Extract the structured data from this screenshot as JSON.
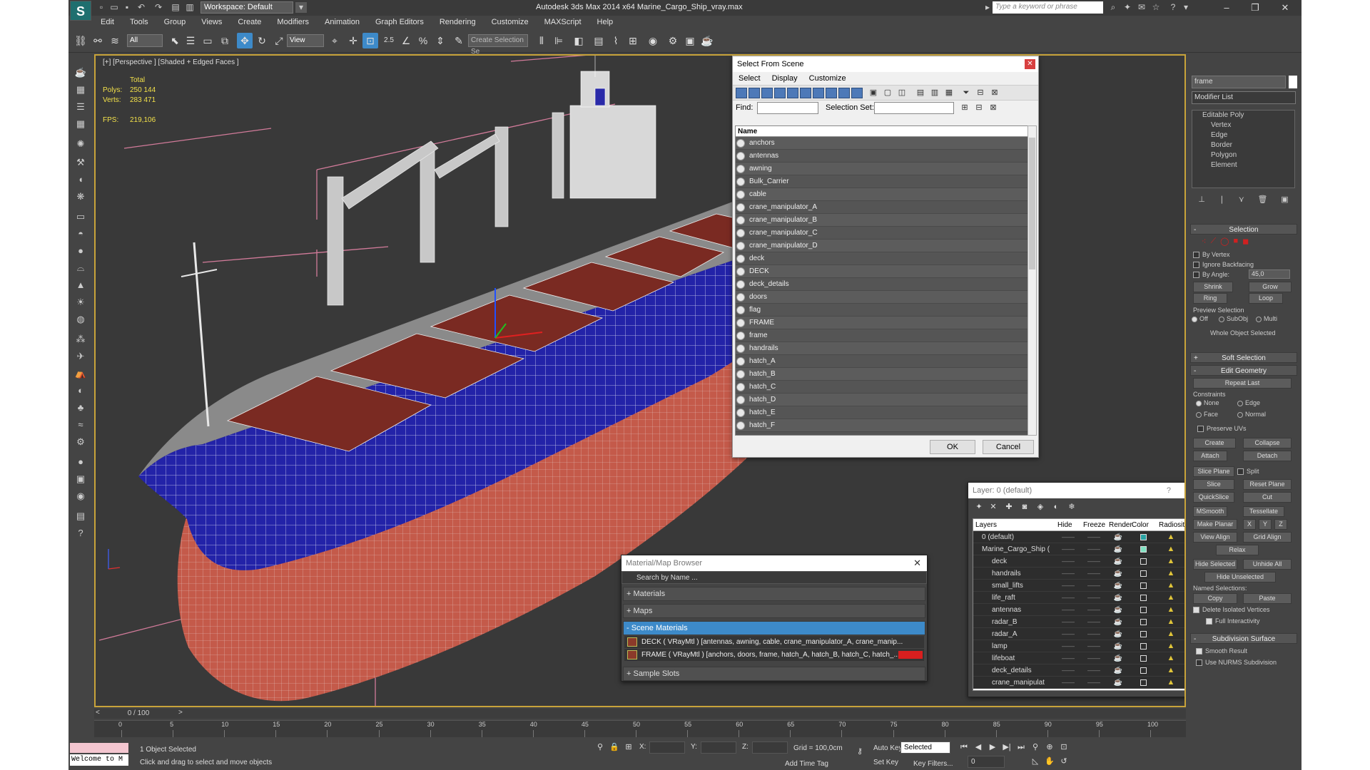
{
  "titlebar": {
    "workspace": "Workspace: Default",
    "title": "Autodesk 3ds Max  2014 x64     Marine_Cargo_Ship_vray.max",
    "search_placeholder": "Type a keyword or phrase"
  },
  "menu": [
    "Edit",
    "Tools",
    "Group",
    "Views",
    "Create",
    "Modifiers",
    "Animation",
    "Graph Editors",
    "Rendering",
    "Customize",
    "MAXScript",
    "Help"
  ],
  "toolbar": {
    "filter_value": "All",
    "refcoord_value": "View",
    "snap_angle": "2.5",
    "selection_set_placeholder": "Create Selection Se"
  },
  "viewport": {
    "label": "[+] [Perspective ] [Shaded + Edged Faces ]",
    "stats": {
      "total_label": "Total",
      "polys_label": "Polys:",
      "polys": "250 144",
      "verts_label": "Verts:",
      "verts": "283 471",
      "fps_label": "FPS:",
      "fps": "219,106"
    }
  },
  "select_from_scene": {
    "title": "Select From Scene",
    "menu": [
      "Select",
      "Display",
      "Customize"
    ],
    "find_label": "Find:",
    "selection_set_label": "Selection Set:",
    "column_name": "Name",
    "items": [
      "anchors",
      "antennas",
      "awning",
      "Bulk_Carrier",
      "cable",
      "crane_manipulator_A",
      "crane_manipulator_B",
      "crane_manipulator_C",
      "crane_manipulator_D",
      "deck",
      "DECK",
      "deck_details",
      "doors",
      "flag",
      "FRAME",
      "frame",
      "handrails",
      "hatch_A",
      "hatch_B",
      "hatch_C",
      "hatch_D",
      "hatch_E",
      "hatch_F"
    ],
    "ok": "OK",
    "cancel": "Cancel"
  },
  "material_browser": {
    "title": "Material/Map Browser",
    "search_placeholder": "Search by Name ...",
    "rollouts": {
      "materials": "+ Materials",
      "maps": "+ Maps",
      "scene": "- Scene Materials",
      "samples": "+ Sample Slots"
    },
    "scene_materials": [
      "DECK  ( VRayMtl )  [antennas, awning, cable, crane_manipulator_A, crane_manip...",
      "FRAME  ( VRayMtl )  [anchors, doors, frame, hatch_A, hatch_B, hatch_C, hatch_..."
    ]
  },
  "layer_dialog": {
    "title": "Layer: 0 (default)",
    "help": "?",
    "columns": [
      "Layers",
      "Hide",
      "Freeze",
      "Render",
      "Color",
      "Radiosity"
    ],
    "rows": [
      {
        "name": "0 (default)",
        "color": "#2aa3a3",
        "indent": 0
      },
      {
        "name": "Marine_Cargo_Ship (",
        "color": "#7fe0c0",
        "indent": 0
      },
      {
        "name": "deck",
        "color": "#2d2d2d",
        "indent": 1
      },
      {
        "name": "handrails",
        "color": "#2d2d2d",
        "indent": 1
      },
      {
        "name": "small_lifts",
        "color": "#2d2d2d",
        "indent": 1
      },
      {
        "name": "life_raft",
        "color": "#2d2d2d",
        "indent": 1
      },
      {
        "name": "antennas",
        "color": "#2d2d2d",
        "indent": 1
      },
      {
        "name": "radar_B",
        "color": "#2d2d2d",
        "indent": 1
      },
      {
        "name": "radar_A",
        "color": "#2d2d2d",
        "indent": 1
      },
      {
        "name": "lamp",
        "color": "#2d2d2d",
        "indent": 1
      },
      {
        "name": "lifeboat",
        "color": "#2d2d2d",
        "indent": 1
      },
      {
        "name": "deck_details",
        "color": "#2d2d2d",
        "indent": 1
      },
      {
        "name": "crane_manipulat",
        "color": "#2d2d2d",
        "indent": 1
      }
    ]
  },
  "command_panel": {
    "object_name": "frame",
    "modifier_list": "Modifier List",
    "stack": [
      "Editable Poly",
      "Vertex",
      "Edge",
      "Border",
      "Polygon",
      "Element"
    ],
    "selection": {
      "title": "Selection",
      "by_vertex": "By Vertex",
      "ignore_backfacing": "Ignore Backfacing",
      "by_angle": "By Angle:",
      "angle_value": "45,0",
      "shrink": "Shrink",
      "grow": "Grow",
      "ring": "Ring",
      "loop": "Loop",
      "preview": "Preview Selection",
      "off": "Off",
      "subobj": "SubObj",
      "multi": "Multi",
      "whole": "Whole Object Selected"
    },
    "soft_selection": "Soft Selection",
    "edit_geometry": {
      "title": "Edit Geometry",
      "repeat_last": "Repeat Last",
      "constraints": "Constraints",
      "none": "None",
      "edge": "Edge",
      "face": "Face",
      "normal": "Normal",
      "preserve_uvs": "Preserve UVs",
      "create": "Create",
      "collapse": "Collapse",
      "attach": "Attach",
      "detach": "Detach",
      "slice_plane": "Slice Plane",
      "split": "Split",
      "slice": "Slice",
      "reset_plane": "Reset Plane",
      "quickslice": "QuickSlice",
      "cut": "Cut",
      "msmooth": "MSmooth",
      "tessellate": "Tessellate",
      "make_planar": "Make Planar",
      "x": "X",
      "y": "Y",
      "z": "Z",
      "view_align": "View Align",
      "grid_align": "Grid Align",
      "relax": "Relax",
      "hide_selected": "Hide Selected",
      "unhide_all": "Unhide All",
      "hide_unselected": "Hide Unselected",
      "named_selections": "Named Selections:",
      "copy": "Copy",
      "paste": "Paste",
      "delete_isolated": "Delete Isolated Vertices",
      "full_interactivity": "Full Interactivity"
    },
    "subdivision": {
      "title": "Subdivision Surface",
      "smooth_result": "Smooth Result",
      "nurms": "Use NURMS Subdivision"
    }
  },
  "timeline": {
    "frame": "0 / 100",
    "ticks": [
      "0",
      "5",
      "10",
      "15",
      "20",
      "25",
      "30",
      "35",
      "40",
      "45",
      "50",
      "55",
      "60",
      "65",
      "70",
      "75",
      "80",
      "85",
      "90",
      "95",
      "100"
    ]
  },
  "status": {
    "welcome": "Welcome to M",
    "selected": "1 Object Selected",
    "prompt": "Click and drag to select and move objects",
    "x_label": "X:",
    "y_label": "Y:",
    "z_label": "Z:",
    "grid": "Grid = 100,0cm",
    "auto_key": "Auto Key",
    "set_key": "Set Key",
    "key_mode": "Selected",
    "key_filters": "Key Filters...",
    "add_time_tag": "Add Time Tag",
    "current_frame": "0"
  }
}
